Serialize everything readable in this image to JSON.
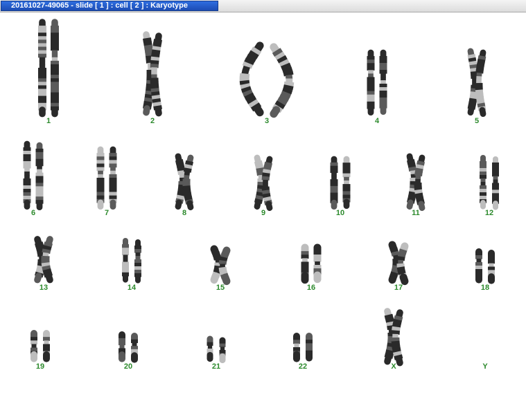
{
  "window": {
    "title": "20161027-49065 - slide [ 1 ] : cell [ 2 ] : Karyotype"
  },
  "colors": {
    "label": "#2c8a2c",
    "chromosome_dark": "#2a2a2a",
    "chromosome_light": "#bdbdbd",
    "title_bar": "#1f56c7"
  },
  "karyotype": {
    "pairs": [
      {
        "label": "1"
      },
      {
        "label": "2"
      },
      {
        "label": "3"
      },
      {
        "label": "4"
      },
      {
        "label": "5"
      },
      {
        "label": "6"
      },
      {
        "label": "7"
      },
      {
        "label": "8"
      },
      {
        "label": "9"
      },
      {
        "label": "10"
      },
      {
        "label": "11"
      },
      {
        "label": "12"
      },
      {
        "label": "13"
      },
      {
        "label": "14"
      },
      {
        "label": "15"
      },
      {
        "label": "16"
      },
      {
        "label": "17"
      },
      {
        "label": "18"
      },
      {
        "label": "19"
      },
      {
        "label": "20"
      },
      {
        "label": "21"
      },
      {
        "label": "22"
      },
      {
        "label": "X"
      },
      {
        "label": "Y"
      }
    ]
  }
}
